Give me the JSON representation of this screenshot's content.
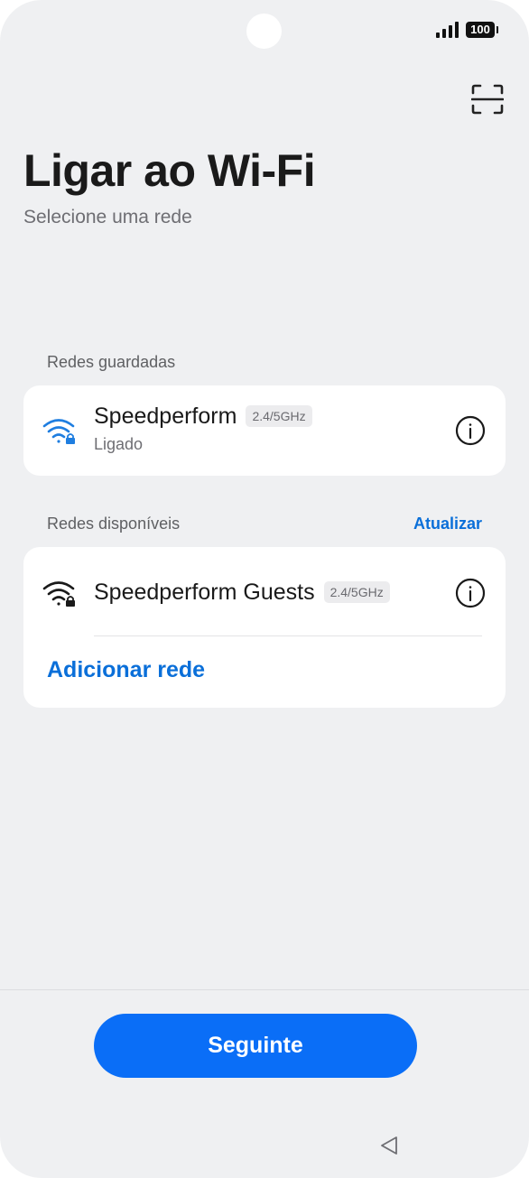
{
  "status_bar": {
    "battery": "100",
    "signal_icon": "signal-icon"
  },
  "header": {
    "title": "Ligar ao Wi-Fi",
    "subtitle": "Selecione uma rede",
    "scan_icon": "scan-icon"
  },
  "saved_networks": {
    "label": "Redes guardadas",
    "items": [
      {
        "name": "Speedperform",
        "band": "2.4/5GHz",
        "status": "Ligado",
        "icon": "wifi-lock-icon",
        "icon_color": "#1f7ee0"
      }
    ]
  },
  "available_networks": {
    "label": "Redes disponíveis",
    "refresh_label": "Atualizar",
    "items": [
      {
        "name": "Speedperform Guests",
        "band": "2.4/5GHz",
        "icon": "wifi-lock-icon",
        "icon_color": "#1a1a1a"
      }
    ],
    "add_label": "Adicionar rede"
  },
  "footer": {
    "next_label": "Seguinte"
  },
  "colors": {
    "accent": "#0a6ef7",
    "link": "#0a6fd9",
    "background": "#eff0f2"
  }
}
